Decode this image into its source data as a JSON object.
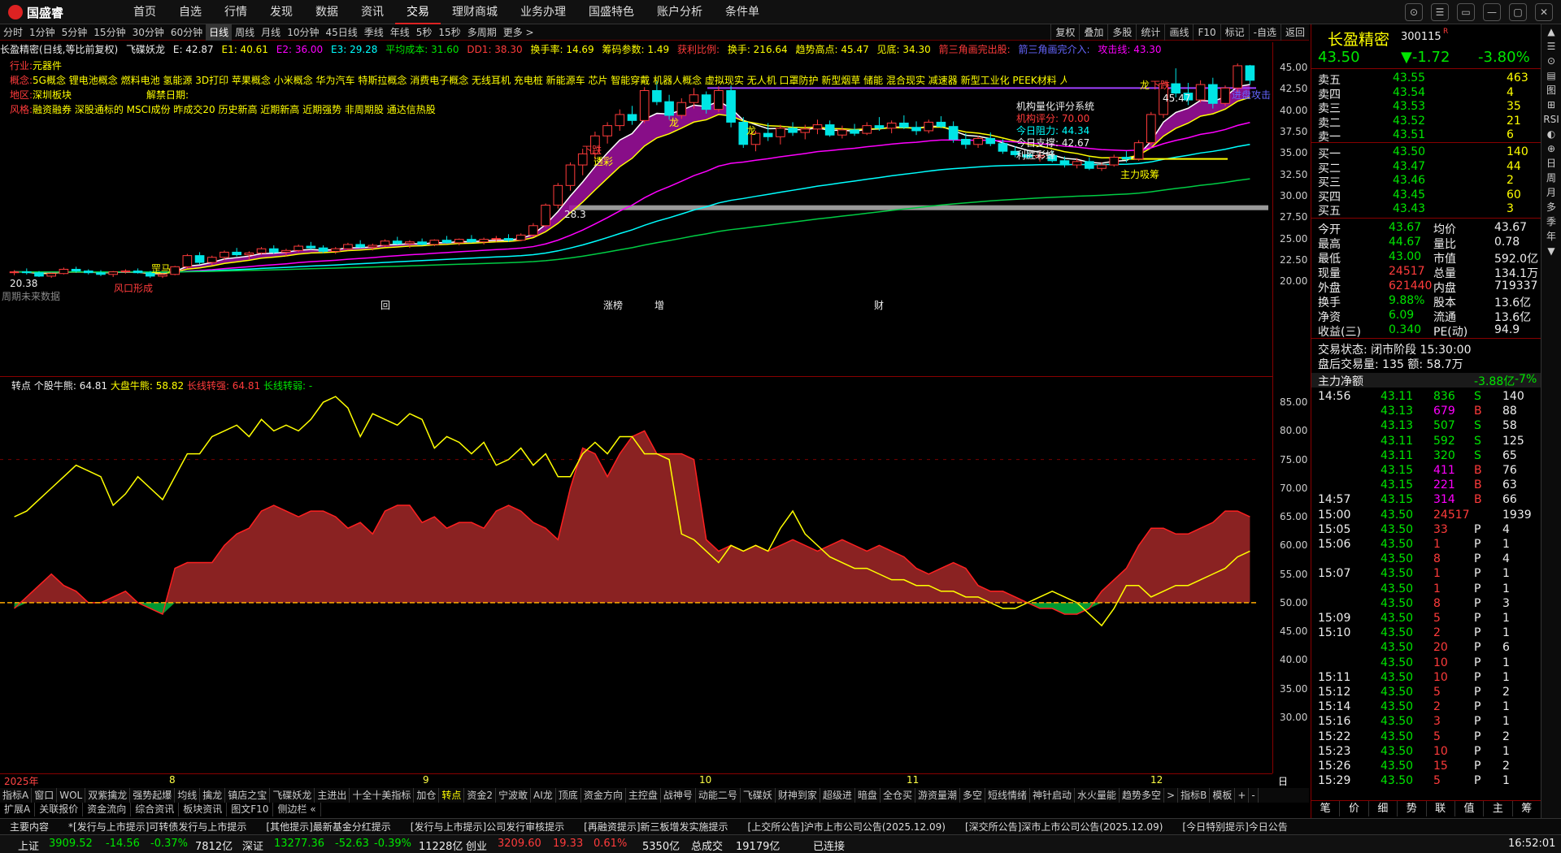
{
  "app": {
    "name": "国盛睿",
    "menu": [
      "首页",
      "自选",
      "行情",
      "发现",
      "数据",
      "资讯",
      "交易",
      "理财商城",
      "业务办理",
      "国盛特色",
      "账户分析",
      "条件单"
    ],
    "active_menu": "交易",
    "window_buttons": [
      "⊙",
      "☰",
      "▭",
      "—",
      "▢",
      "✕"
    ]
  },
  "periods": {
    "items": [
      "分时",
      "1分钟",
      "5分钟",
      "15分钟",
      "30分钟",
      "60分钟",
      "日线",
      "周线",
      "月线",
      "10分钟",
      "45日线",
      "季线",
      "年线",
      "5秒",
      "15秒",
      "多周期",
      "更多 >"
    ],
    "active": "日线",
    "right": [
      "复权",
      "叠加",
      "多股",
      "统计",
      "画线",
      "F10",
      "标记",
      "-自选",
      "返回"
    ]
  },
  "info": {
    "title": "长盈精密(日线,等比前复权)",
    "name": "飞碟妖龙",
    "e": "E: 42.87",
    "e1": "E1: 40.61",
    "e2": "E2: 36.00",
    "e3": "E3: 29.28",
    "avg": "平均成本: 31.60",
    "dd1": "DD1: 38.30",
    "turnover": "换手率: 14.69",
    "chip": "筹码参数: 1.49",
    "profit": "获利比例:",
    "hs": "换手: 216.64",
    "trend": "趋势高点: 45.47",
    "low": "见底: 34.30",
    "tri": "箭三角画完出股:",
    "tri2": "箭三角画完介入:",
    "attack": "攻击线: 43.30"
  },
  "tags": {
    "industry_label": "行业:",
    "industry": "元器件",
    "concept_label": "概念:",
    "concepts": "5G概念 锂电池概念 燃料电池 氢能源 3D打印 苹果概念 小米概念 华为汽车 特斯拉概念 消费电子概念 无线耳机 充电桩 新能源车 芯片 智能穿戴 机器人概念 虚拟现实 无人机 口罩防护 新型烟草 储能 混合现实 减速器 新型工业化 PEEK材料 人形机器人 AI手机PC 铜缆高速连接",
    "region_label": "地区:",
    "region": "深圳板块",
    "lift_label": "解禁日期:",
    "style_label": "风格:",
    "style": "融资融券 深股通标的 MSCI成份 昨成交20 历史新高 近期新高 近期强势 非周期股 通达信热股"
  },
  "annotations": {
    "quant": [
      "机构量化评分系统",
      "机构评分: 70.00",
      "今日阻力: 44.34",
      "今日支撑: 42.67",
      "利胜彩蜂"
    ],
    "longs": [
      "龙",
      "龙",
      "龙",
      "龙"
    ],
    "xiadie": "下跌",
    "tousui": "透彩",
    "shangma": "罡马",
    "chuhai": "出海",
    "fengkou": "风口形成",
    "mainpush": "主力吸筹",
    "left_low": "20.38",
    "left_note": "周期未来数据",
    "right_price": "45.47",
    "right_note": "进盘攻击",
    "marker": "28.3",
    "bottom_marks": [
      "回",
      "涨榜",
      "增",
      "财"
    ]
  },
  "price_axis": [
    "45.00",
    "42.50",
    "40.00",
    "37.50",
    "35.00",
    "32.50",
    "30.00",
    "27.50",
    "25.00",
    "22.50",
    "20.00"
  ],
  "ind_header": {
    "name": "转点",
    "single": "个股牛熊: 64.81",
    "market": "大盘牛熊: 58.82",
    "long_strong": "长线转强: 64.81",
    "long_weak": "长线转弱: -"
  },
  "ind_axis": [
    "85.00",
    "80.00",
    "75.00",
    "70.00",
    "65.00",
    "60.00",
    "55.00",
    "50.00",
    "45.00",
    "40.00",
    "35.00",
    "30.00"
  ],
  "x_axis": {
    "year": "2025年",
    "months": [
      "8",
      "9",
      "10",
      "11",
      "12"
    ],
    "right": "日线"
  },
  "indtabs": {
    "items": [
      "指标A",
      "窗口",
      "WOL",
      "双紫擒龙",
      "强势起爆",
      "均线",
      "擒龙",
      "镇店之宝",
      "飞碟妖龙",
      "主进出",
      "十全十美指标",
      "加仓",
      "转点",
      "资金2",
      "宁波敢",
      "AI龙",
      "顶底",
      "资金方向",
      "主控盘",
      "战神号",
      "动能二号",
      "飞碟妖",
      "财神到家",
      "超级进",
      "暗盘",
      "全仓买",
      "游资量潮",
      "多空",
      "短线情绪",
      "神针启动",
      "水火量能",
      "趋势多空",
      ">",
      "指标B",
      "模板",
      "+",
      "-"
    ],
    "active": "转点"
  },
  "subtabs": [
    "扩展A",
    "关联报价",
    "资金流向",
    "综合资讯",
    "板块资讯",
    "图文F10",
    "侧边栏 «"
  ],
  "news": [
    "主要内容",
    "*[发行与上市提示]可转债发行与上市提示",
    "[其他提示]最新基金分红提示",
    "[发行与上市提示]公司发行审核提示",
    "[再融资提示]新三板增发实施提示",
    "[上交所公告]沪市上市公司公告(2025.12.09)",
    "[深交所公告]深市上市公司公告(2025.12.09)",
    "[今日特别提示]今日公告"
  ],
  "status": {
    "sh_label": "上证",
    "sh": "3909.52",
    "sh_chg": "-14.56",
    "sh_pct": "-0.37%",
    "sh_vol": "7812亿",
    "sz_label": "深证",
    "sz": "13277.36",
    "sz_chg": "-52.63",
    "sz_pct": "-0.39%",
    "sz_vol": "11228亿",
    "cy_label": "创业",
    "cy": "3209.60",
    "cy_chg": "19.33",
    "cy_pct": "0.61%",
    "cy_vol": "5350亿",
    "total_label": "总成交",
    "total": "19179亿",
    "conn": "已连接",
    "time": "16:52:01"
  },
  "stock": {
    "name": "长盈精密",
    "code": "300115",
    "flag": "R",
    "price": "43.50",
    "change": "▼-1.72",
    "pct": "-3.80%"
  },
  "orderbook": {
    "asks": [
      {
        "l": "卖五",
        "p": "43.55",
        "v": "463"
      },
      {
        "l": "卖四",
        "p": "43.54",
        "v": "4"
      },
      {
        "l": "卖三",
        "p": "43.53",
        "v": "35"
      },
      {
        "l": "卖二",
        "p": "43.52",
        "v": "21"
      },
      {
        "l": "卖一",
        "p": "43.51",
        "v": "6"
      }
    ],
    "bids": [
      {
        "l": "买一",
        "p": "43.50",
        "v": "140"
      },
      {
        "l": "买二",
        "p": "43.47",
        "v": "44"
      },
      {
        "l": "买三",
        "p": "43.46",
        "v": "2"
      },
      {
        "l": "买四",
        "p": "43.45",
        "v": "60"
      },
      {
        "l": "买五",
        "p": "43.43",
        "v": "3"
      }
    ]
  },
  "quote": [
    {
      "a": "今开",
      "av": "43.67",
      "b": "均价",
      "bv": "43.67"
    },
    {
      "a": "最高",
      "av": "44.67",
      "b": "量比",
      "bv": "0.78"
    },
    {
      "a": "最低",
      "av": "43.00",
      "b": "市值",
      "bv": "592.0亿"
    },
    {
      "a": "现量",
      "av": "24517",
      "b": "总量",
      "bv": "134.1万"
    },
    {
      "a": "外盘",
      "av": "621440",
      "b": "内盘",
      "bv": "719337"
    },
    {
      "a": "换手",
      "av": "9.88%",
      "b": "股本",
      "bv": "13.6亿"
    },
    {
      "a": "净资",
      "av": "6.09",
      "b": "流通",
      "bv": "13.6亿"
    },
    {
      "a": "收益(三)",
      "av": "0.340",
      "b": "PE(动)",
      "bv": "94.9"
    }
  ],
  "trade_state": {
    "state": "交易状态: 闭市阶段 15:30:00",
    "after": "盘后交易量: 135  额: 58.7万"
  },
  "flow": {
    "label": "主力净额",
    "value": "-3.88亿",
    "pct": "-7%"
  },
  "ticks": [
    {
      "t": "14:56",
      "p": "43.11",
      "v": "836",
      "d": "S",
      "n": "140"
    },
    {
      "t": "",
      "p": "43.13",
      "v": "679",
      "d": "B",
      "n": "88"
    },
    {
      "t": "",
      "p": "43.13",
      "v": "507",
      "d": "S",
      "n": "58"
    },
    {
      "t": "",
      "p": "43.11",
      "v": "592",
      "d": "S",
      "n": "125"
    },
    {
      "t": "",
      "p": "43.11",
      "v": "320",
      "d": "S",
      "n": "65"
    },
    {
      "t": "",
      "p": "43.15",
      "v": "411",
      "d": "B",
      "n": "76"
    },
    {
      "t": "",
      "p": "43.15",
      "v": "221",
      "d": "B",
      "n": "63"
    },
    {
      "t": "14:57",
      "p": "43.15",
      "v": "314",
      "d": "B",
      "n": "66"
    },
    {
      "t": "15:00",
      "p": "43.50",
      "v": "24517",
      "d": "",
      "n": "1939"
    },
    {
      "t": "15:05",
      "p": "43.50",
      "v": "33",
      "d": "P",
      "n": "4"
    },
    {
      "t": "15:06",
      "p": "43.50",
      "v": "1",
      "d": "P",
      "n": "1"
    },
    {
      "t": "",
      "p": "43.50",
      "v": "8",
      "d": "P",
      "n": "4"
    },
    {
      "t": "15:07",
      "p": "43.50",
      "v": "1",
      "d": "P",
      "n": "1"
    },
    {
      "t": "",
      "p": "43.50",
      "v": "1",
      "d": "P",
      "n": "1"
    },
    {
      "t": "",
      "p": "43.50",
      "v": "8",
      "d": "P",
      "n": "3"
    },
    {
      "t": "15:09",
      "p": "43.50",
      "v": "5",
      "d": "P",
      "n": "1"
    },
    {
      "t": "15:10",
      "p": "43.50",
      "v": "2",
      "d": "P",
      "n": "1"
    },
    {
      "t": "",
      "p": "43.50",
      "v": "20",
      "d": "P",
      "n": "6"
    },
    {
      "t": "",
      "p": "43.50",
      "v": "10",
      "d": "P",
      "n": "1"
    },
    {
      "t": "15:11",
      "p": "43.50",
      "v": "10",
      "d": "P",
      "n": "1"
    },
    {
      "t": "15:12",
      "p": "43.50",
      "v": "5",
      "d": "P",
      "n": "2"
    },
    {
      "t": "15:14",
      "p": "43.50",
      "v": "2",
      "d": "P",
      "n": "1"
    },
    {
      "t": "15:16",
      "p": "43.50",
      "v": "3",
      "d": "P",
      "n": "1"
    },
    {
      "t": "15:22",
      "p": "43.50",
      "v": "5",
      "d": "P",
      "n": "2"
    },
    {
      "t": "15:23",
      "p": "43.50",
      "v": "10",
      "d": "P",
      "n": "1"
    },
    {
      "t": "15:26",
      "p": "43.50",
      "v": "15",
      "d": "P",
      "n": "2"
    },
    {
      "t": "15:29",
      "p": "43.50",
      "v": "5",
      "d": "P",
      "n": "1"
    }
  ],
  "rp_tabs": [
    "笔",
    "价",
    "细",
    "势",
    "联",
    "值",
    "主",
    "筹"
  ],
  "sidebar": [
    "▲",
    "☰",
    "⊙",
    "▤",
    "图",
    "⊞",
    "RSI",
    "◐",
    "⊕",
    "日",
    "周",
    "月",
    "多",
    "季",
    "年",
    "▼"
  ],
  "chart_data": {
    "type": "candlestick",
    "title": "长盈精密(日线,等比前复权)",
    "ylim": [
      18.5,
      47
    ],
    "y_ticks": [
      45,
      42.5,
      40,
      37.5,
      35,
      32.5,
      30,
      27.5,
      25,
      22.5,
      20
    ],
    "ohlc": [
      [
        21.0,
        21.3,
        20.7,
        21.1
      ],
      [
        21.1,
        21.5,
        20.8,
        21.0
      ],
      [
        21.0,
        21.2,
        20.5,
        20.6
      ],
      [
        20.6,
        21.0,
        20.4,
        20.9
      ],
      [
        20.9,
        21.6,
        20.8,
        21.4
      ],
      [
        21.4,
        21.7,
        21.0,
        21.2
      ],
      [
        21.2,
        21.4,
        20.8,
        21.0
      ],
      [
        21.0,
        21.3,
        20.6,
        20.8
      ],
      [
        20.8,
        21.2,
        20.5,
        21.1
      ],
      [
        21.1,
        21.4,
        20.9,
        21.2
      ],
      [
        21.2,
        21.5,
        20.9,
        21.0
      ],
      [
        21.0,
        21.2,
        20.4,
        20.6
      ],
      [
        20.6,
        20.9,
        20.38,
        20.8
      ],
      [
        20.8,
        21.8,
        20.7,
        21.7
      ],
      [
        21.7,
        23.2,
        21.5,
        23.0
      ],
      [
        23.0,
        23.4,
        22.0,
        22.2
      ],
      [
        22.2,
        23.0,
        21.9,
        22.8
      ],
      [
        22.8,
        23.6,
        22.5,
        23.4
      ],
      [
        23.4,
        23.9,
        22.9,
        23.1
      ],
      [
        23.1,
        23.5,
        22.6,
        23.3
      ],
      [
        23.3,
        24.0,
        23.1,
        23.8
      ],
      [
        23.8,
        24.2,
        23.2,
        23.4
      ],
      [
        23.4,
        23.8,
        22.9,
        23.6
      ],
      [
        23.6,
        24.3,
        23.4,
        24.1
      ],
      [
        24.1,
        24.6,
        23.7,
        23.9
      ],
      [
        23.9,
        24.2,
        23.3,
        23.5
      ],
      [
        23.5,
        24.0,
        23.2,
        23.8
      ],
      [
        23.8,
        24.5,
        23.6,
        24.3
      ],
      [
        24.3,
        24.8,
        23.9,
        24.0
      ],
      [
        24.0,
        24.4,
        23.6,
        24.2
      ],
      [
        24.2,
        24.9,
        24.0,
        24.7
      ],
      [
        24.7,
        25.2,
        24.3,
        24.4
      ],
      [
        24.4,
        24.8,
        23.9,
        24.6
      ],
      [
        24.6,
        25.0,
        24.2,
        24.3
      ],
      [
        24.3,
        24.9,
        24.1,
        24.8
      ],
      [
        24.8,
        25.3,
        24.4,
        24.5
      ],
      [
        24.5,
        25.0,
        24.2,
        24.9
      ],
      [
        24.9,
        25.4,
        24.5,
        24.6
      ],
      [
        24.6,
        25.1,
        24.3,
        24.9
      ],
      [
        24.9,
        25.3,
        24.6,
        25.0
      ],
      [
        25.0,
        25.5,
        24.6,
        24.8
      ],
      [
        24.8,
        25.6,
        24.7,
        25.4
      ],
      [
        25.4,
        26.8,
        25.2,
        26.5
      ],
      [
        26.5,
        29.1,
        26.3,
        28.9
      ],
      [
        28.9,
        31.5,
        28.5,
        31.2
      ],
      [
        31.2,
        33.9,
        30.6,
        33.6
      ],
      [
        33.6,
        35.5,
        32.4,
        34.9
      ],
      [
        34.9,
        37.5,
        34.2,
        37.0
      ],
      [
        37.0,
        38.6,
        36.1,
        38.2
      ],
      [
        38.2,
        40.1,
        37.6,
        39.5
      ],
      [
        39.5,
        40.5,
        38.3,
        38.8
      ],
      [
        38.8,
        42.7,
        38.5,
        42.3
      ],
      [
        42.3,
        43.4,
        40.6,
        41.0
      ],
      [
        41.0,
        41.8,
        38.9,
        39.4
      ],
      [
        39.4,
        41.4,
        39.0,
        40.9
      ],
      [
        40.9,
        42.6,
        40.2,
        41.8
      ],
      [
        41.8,
        42.2,
        39.6,
        40.1
      ],
      [
        40.1,
        42.8,
        39.8,
        42.3
      ],
      [
        42.3,
        42.9,
        38.0,
        38.6
      ],
      [
        38.6,
        39.2,
        35.6,
        36.0
      ],
      [
        36.0,
        37.6,
        35.2,
        37.3
      ],
      [
        37.3,
        38.5,
        36.4,
        36.9
      ],
      [
        36.9,
        38.3,
        36.0,
        37.9
      ],
      [
        37.9,
        38.6,
        37.0,
        37.4
      ],
      [
        37.4,
        38.3,
        36.6,
        37.8
      ],
      [
        37.8,
        38.9,
        37.2,
        38.3
      ],
      [
        38.3,
        38.8,
        36.9,
        37.1
      ],
      [
        37.1,
        38.2,
        36.7,
        37.7
      ],
      [
        37.7,
        38.4,
        37.0,
        37.3
      ],
      [
        37.3,
        38.6,
        37.1,
        38.2
      ],
      [
        38.2,
        39.2,
        37.6,
        37.9
      ],
      [
        37.9,
        38.8,
        37.3,
        38.5
      ],
      [
        38.5,
        39.4,
        37.8,
        38.0
      ],
      [
        38.0,
        38.7,
        37.1,
        37.6
      ],
      [
        37.6,
        38.9,
        37.3,
        38.6
      ],
      [
        38.6,
        39.3,
        37.9,
        38.1
      ],
      [
        38.1,
        38.7,
        36.2,
        36.6
      ],
      [
        36.6,
        37.3,
        35.5,
        36.0
      ],
      [
        36.0,
        37.0,
        35.6,
        36.7
      ],
      [
        36.7,
        37.4,
        35.8,
        36.1
      ],
      [
        36.1,
        36.6,
        34.9,
        35.2
      ],
      [
        35.2,
        35.8,
        34.5,
        34.8
      ],
      [
        34.8,
        35.3,
        34.3,
        34.5
      ],
      [
        34.5,
        35.1,
        34.0,
        34.7
      ],
      [
        34.7,
        35.2,
        33.9,
        34.1
      ],
      [
        34.1,
        34.6,
        33.3,
        33.6
      ],
      [
        33.6,
        34.4,
        33.2,
        34.0
      ],
      [
        34.0,
        34.5,
        33.0,
        33.2
      ],
      [
        33.2,
        33.9,
        32.9,
        33.6
      ],
      [
        33.6,
        34.8,
        33.4,
        34.5
      ],
      [
        34.5,
        35.2,
        33.9,
        34.3
      ],
      [
        34.3,
        36.5,
        34.1,
        36.2
      ],
      [
        36.2,
        39.8,
        35.9,
        39.5
      ],
      [
        39.5,
        43.4,
        39.1,
        43.1
      ],
      [
        43.1,
        44.9,
        41.5,
        42.0
      ],
      [
        42.0,
        43.2,
        40.6,
        41.2
      ],
      [
        41.2,
        43.5,
        40.9,
        43.0
      ],
      [
        43.0,
        43.8,
        40.2,
        40.8
      ],
      [
        40.8,
        42.9,
        40.5,
        42.6
      ],
      [
        42.6,
        45.47,
        42.1,
        45.2
      ],
      [
        45.2,
        45.3,
        43.0,
        43.5
      ]
    ],
    "ma": [
      {
        "name": "E",
        "color": "#ffffff"
      },
      {
        "name": "E1",
        "color": "#ffff00"
      },
      {
        "name": "E2",
        "color": "#ff00ff"
      },
      {
        "name": "E3",
        "color": "#00ffff"
      }
    ],
    "indicator": {
      "name": "转点",
      "ylim": [
        27,
        88
      ],
      "baseline": 50,
      "series": [
        {
          "name": "个股牛熊",
          "color": "#cc0000"
        },
        {
          "name": "大盘牛熊",
          "color": "#ffff00"
        }
      ],
      "single": [
        49,
        51,
        53,
        55,
        53,
        52,
        50,
        50,
        51,
        52,
        50,
        49,
        48,
        56,
        57,
        57,
        57,
        60,
        62,
        63,
        66,
        67,
        66,
        65,
        66,
        66,
        65,
        63,
        64,
        62,
        66,
        67,
        67,
        64,
        65,
        63,
        64,
        64,
        63,
        66,
        67,
        66,
        64,
        63,
        61,
        70,
        77,
        76,
        72,
        76,
        79,
        80,
        76,
        76,
        76,
        75,
        61,
        59,
        60,
        59,
        60,
        59,
        60,
        61,
        60,
        59,
        60,
        61,
        60,
        59,
        60,
        59,
        58,
        56,
        55,
        56,
        57,
        56,
        53,
        52,
        52,
        51,
        50,
        49,
        49,
        48,
        48,
        49,
        52,
        54,
        56,
        60,
        63,
        63,
        62,
        62,
        63,
        64,
        66,
        66,
        65
      ],
      "market": [
        65,
        66,
        68,
        70,
        72,
        74,
        73,
        72,
        67,
        69,
        72,
        70,
        68,
        72,
        76,
        76,
        79,
        80,
        81,
        79,
        82,
        80,
        81,
        80,
        82,
        85,
        86,
        84,
        79,
        83,
        82,
        81,
        83,
        82,
        77,
        79,
        78,
        76,
        78,
        74,
        75,
        77,
        74,
        76,
        72,
        72,
        76,
        78,
        76,
        79,
        79,
        76,
        76,
        75,
        62,
        61,
        59,
        57,
        60,
        59,
        60,
        59,
        63,
        66,
        62,
        60,
        58,
        57,
        56,
        56,
        55,
        54,
        54,
        53,
        53,
        52,
        52,
        51,
        51,
        50,
        49,
        49,
        50,
        51,
        52,
        51,
        50,
        48,
        46,
        49,
        53,
        53,
        51,
        52,
        53,
        53,
        54,
        55,
        56,
        58,
        59
      ]
    }
  }
}
